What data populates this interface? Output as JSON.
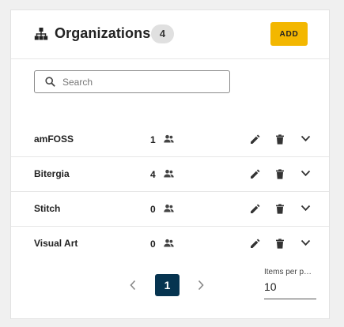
{
  "header": {
    "title": "Organizations",
    "count": "4",
    "add_label": "ADD",
    "icon": "sitemap-icon"
  },
  "search": {
    "placeholder": "Search",
    "value": ""
  },
  "organizations": [
    {
      "name": "amFOSS",
      "members": "1"
    },
    {
      "name": "Bitergia",
      "members": "4"
    },
    {
      "name": "Stitch",
      "members": "0"
    },
    {
      "name": "Visual Art",
      "members": "0"
    }
  ],
  "pagination": {
    "current_page": "1",
    "items_per_page_label": "Items per page",
    "items_per_page_value": "10"
  },
  "colors": {
    "accent": "#f3b700",
    "page_active": "#063450",
    "badge_bg": "#e0e0e0"
  }
}
